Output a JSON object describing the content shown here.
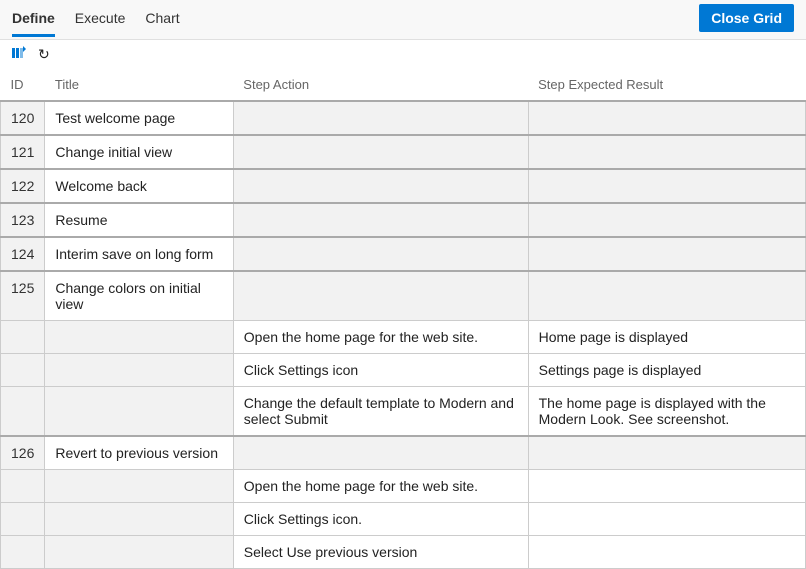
{
  "toolbar": {
    "tabs": [
      {
        "label": "Define",
        "active": true
      },
      {
        "label": "Execute",
        "active": false
      },
      {
        "label": "Chart",
        "active": false
      }
    ],
    "close_label": "Close Grid"
  },
  "columns": {
    "id": "ID",
    "title": "Title",
    "action": "Step Action",
    "expected": "Step Expected Result"
  },
  "rows": [
    {
      "type": "main",
      "id": "120",
      "title": "Test welcome page"
    },
    {
      "type": "main",
      "id": "121",
      "title": "Change initial view"
    },
    {
      "type": "main",
      "id": "122",
      "title": "Welcome back"
    },
    {
      "type": "main",
      "id": "123",
      "title": "Resume"
    },
    {
      "type": "main",
      "id": "124",
      "title": "Interim save on long form"
    },
    {
      "type": "main",
      "id": "125",
      "title": "Change colors on initial view"
    },
    {
      "type": "step",
      "action": "Open the home page for the web site.",
      "expected": "Home page is displayed"
    },
    {
      "type": "step",
      "action": "Click Settings icon",
      "expected": "Settings page is displayed"
    },
    {
      "type": "step",
      "action": "Change the default template to Modern and select Submit",
      "expected": "The home page is displayed with the Modern Look. See screenshot."
    },
    {
      "type": "main",
      "id": "126",
      "title": "Revert to previous version"
    },
    {
      "type": "step",
      "action": "Open the home page for the web site.",
      "expected": ""
    },
    {
      "type": "step",
      "action": "Click Settings icon.",
      "expected": ""
    },
    {
      "type": "step",
      "action": "Select Use previous version",
      "expected": ""
    }
  ]
}
